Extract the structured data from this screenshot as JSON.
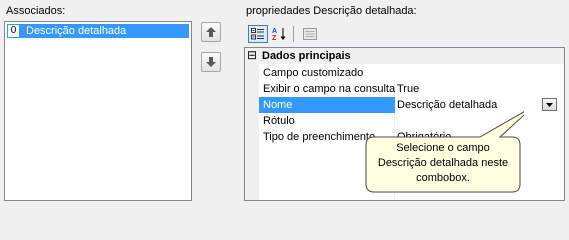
{
  "left_panel": {
    "label": "Associados:",
    "items": [
      {
        "index": "0",
        "text": "Descrição detalhada",
        "selected": true
      }
    ]
  },
  "move_buttons": {
    "up_icon": "arrow-up-icon",
    "down_icon": "arrow-down-icon"
  },
  "right_panel": {
    "label": "propriedades Descrição detalhada:",
    "toolbar": {
      "categorized_icon": "categorized-view-icon",
      "alphabetical_icon": "sort-alphabetical-icon",
      "property_pages_icon": "property-pages-icon"
    },
    "category": {
      "expander": "⊟",
      "title": "Dados principais"
    },
    "properties": [
      {
        "name": "Campo customizado",
        "value": ""
      },
      {
        "name": "Exibir o campo na consulta",
        "value": "True"
      },
      {
        "name": "Nome",
        "value": "Descrição detalhada",
        "selected": true
      },
      {
        "name": "Rótulo",
        "value": ""
      },
      {
        "name": "Tipo de preenchimento",
        "value": "Obrigatório"
      }
    ]
  },
  "callout": {
    "line1": "Selecione o campo",
    "line2": "Descrição detalhada neste",
    "line3": "combobox.",
    "fill": "#ffffe1"
  },
  "colors": {
    "selection": "#3399ff",
    "window_bg": "#f0f0f0",
    "border": "#828790"
  }
}
